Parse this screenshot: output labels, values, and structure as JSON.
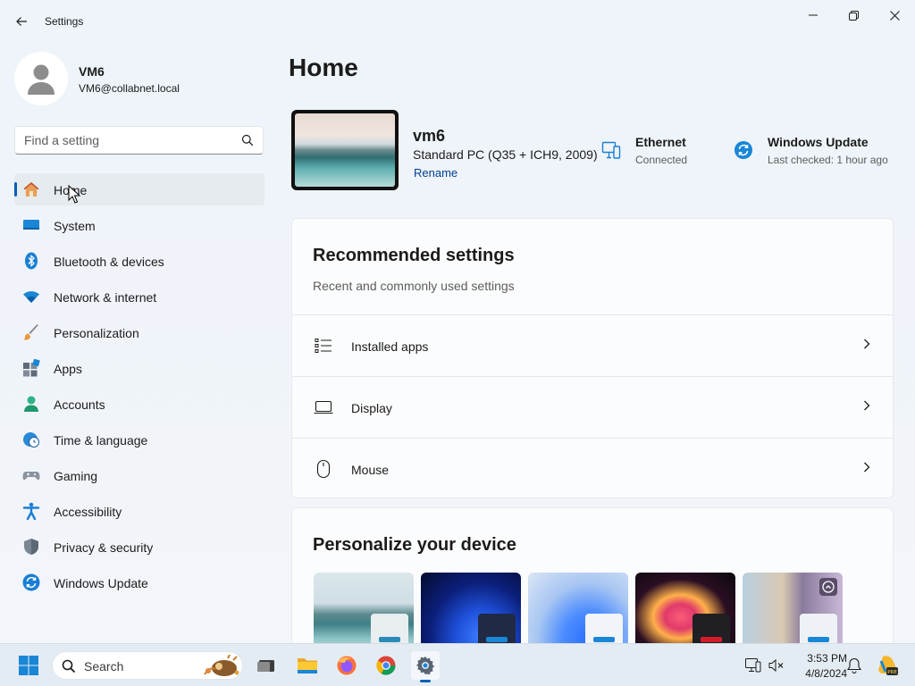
{
  "window": {
    "title": "Settings",
    "back_icon": "back-arrow-icon",
    "minimize_icon": "minimize-icon",
    "maximize_icon": "maximize-icon",
    "close_icon": "close-icon"
  },
  "profile": {
    "name": "VM6",
    "email": "VM6@collabnet.local"
  },
  "search": {
    "placeholder": "Find a setting",
    "value": ""
  },
  "sidebar": {
    "active_index": 0,
    "items": [
      {
        "label": "Home",
        "icon": "home-icon"
      },
      {
        "label": "System",
        "icon": "system-icon"
      },
      {
        "label": "Bluetooth & devices",
        "icon": "bluetooth-icon"
      },
      {
        "label": "Network & internet",
        "icon": "wifi-icon"
      },
      {
        "label": "Personalization",
        "icon": "brush-icon"
      },
      {
        "label": "Apps",
        "icon": "apps-icon"
      },
      {
        "label": "Accounts",
        "icon": "accounts-icon"
      },
      {
        "label": "Time & language",
        "icon": "time-language-icon"
      },
      {
        "label": "Gaming",
        "icon": "gaming-icon"
      },
      {
        "label": "Accessibility",
        "icon": "accessibility-icon"
      },
      {
        "label": "Privacy & security",
        "icon": "shield-icon"
      },
      {
        "label": "Windows Update",
        "icon": "windows-update-icon"
      }
    ]
  },
  "main": {
    "title": "Home",
    "device": {
      "name": "vm6",
      "model": "Standard PC (Q35 + ICH9, 2009)",
      "rename_label": "Rename"
    },
    "status": {
      "ethernet": {
        "title": "Ethernet",
        "subtitle": "Connected"
      },
      "windows_update": {
        "title": "Windows Update",
        "subtitle": "Last checked: 1 hour ago"
      }
    },
    "recommended": {
      "title": "Recommended settings",
      "subtitle": "Recent and commonly used settings",
      "items": [
        {
          "label": "Installed apps",
          "icon": "installed-apps-icon"
        },
        {
          "label": "Display",
          "icon": "display-icon"
        },
        {
          "label": "Mouse",
          "icon": "mouse-icon"
        }
      ]
    },
    "personalize": {
      "title": "Personalize your device",
      "themes": [
        "lake-theme",
        "bloom-dark-theme",
        "bloom-light-theme",
        "flower-theme",
        "blossom-theme"
      ]
    }
  },
  "taskbar": {
    "search_label": "Search",
    "time": "3:53 PM",
    "date": "4/8/2024",
    "accent": "#005fb8"
  }
}
